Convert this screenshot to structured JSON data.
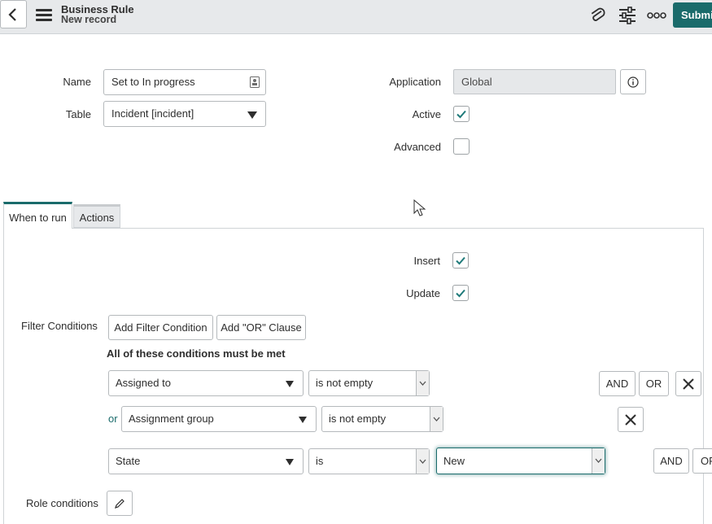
{
  "header": {
    "title": "Business Rule",
    "subtitle": "New record",
    "submit_label": "Submit"
  },
  "form": {
    "name_label": "Name",
    "name_value": "Set to In progress",
    "table_label": "Table",
    "table_value": "Incident [incident]",
    "application_label": "Application",
    "application_value": "Global",
    "active_label": "Active",
    "active_checked": true,
    "advanced_label": "Advanced",
    "advanced_checked": false
  },
  "tabs": [
    {
      "label": "When to run",
      "active": true
    },
    {
      "label": "Actions",
      "active": false
    }
  ],
  "when_to_run": {
    "insert_label": "Insert",
    "insert_checked": true,
    "update_label": "Update",
    "update_checked": true,
    "filter_label": "Filter Conditions",
    "add_filter_label": "Add Filter Condition",
    "add_or_label": "Add \"OR\" Clause",
    "all_conditions_text": "All of these conditions must be met",
    "conditions": [
      {
        "prefix": "",
        "field": "Assigned to",
        "operator": "is not empty",
        "value": ""
      },
      {
        "prefix": "or",
        "field": "Assignment group",
        "operator": "is not empty",
        "value": ""
      },
      {
        "prefix": "",
        "field": "State",
        "operator": "is",
        "value": "New"
      }
    ],
    "and_label": "AND",
    "or_label": "OR",
    "role_conditions_label": "Role conditions"
  },
  "colors": {
    "accent": "#1a6b6b",
    "check": "#1f7a7a"
  }
}
